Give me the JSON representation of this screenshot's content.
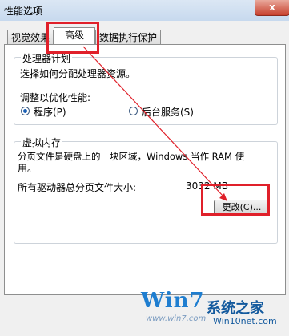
{
  "window": {
    "title": "性能选项",
    "close_glyph": "x"
  },
  "tabs": [
    {
      "label": "视觉效果",
      "active": false
    },
    {
      "label": "高级",
      "active": true
    },
    {
      "label": "数据执行保护",
      "active": false
    }
  ],
  "processor": {
    "title": "处理器计划",
    "description": "选择如何分配处理器资源。",
    "optimize_label": "调整以优化性能:",
    "options": [
      {
        "label": "程序(P)",
        "selected": true
      },
      {
        "label": "后台服务(S)",
        "selected": false
      }
    ]
  },
  "virtual_memory": {
    "title": "虚拟内存",
    "description_line1": "分页文件是硬盘上的一块区域，Windows 当作 RAM 使",
    "description_line2": "用。",
    "total_label": "所有驱动器总分页文件大小:",
    "total_value": "3032 MB",
    "change_button": "更改(C)..."
  },
  "watermark": {
    "logo_text": "Win7",
    "brand": "系统之家",
    "url": "Win10net.com",
    "tagline": "www.win7.com"
  },
  "colors": {
    "highlight": "#e0202a",
    "accent": "#1f7ed0"
  }
}
